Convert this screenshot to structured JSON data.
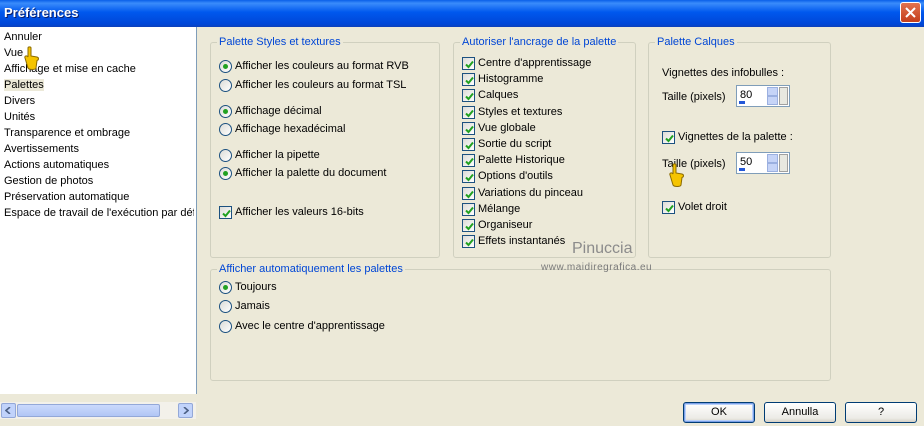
{
  "window": {
    "title": "Préférences"
  },
  "sidebar": {
    "items": [
      {
        "label": "Annuler"
      },
      {
        "label": "Vue"
      },
      {
        "label": "Affichage et mise en cache"
      },
      {
        "label": "Palettes"
      },
      {
        "label": "Divers"
      },
      {
        "label": "Unités"
      },
      {
        "label": "Transparence et ombrage"
      },
      {
        "label": "Avertissements"
      },
      {
        "label": "Actions automatiques"
      },
      {
        "label": "Gestion de photos"
      },
      {
        "label": "Préservation automatique"
      },
      {
        "label": "Espace de travail de l'exécution par déf"
      }
    ],
    "selected": "Palettes"
  },
  "group_styles": {
    "title": "Palette Styles et textures",
    "opt_rvb": "Afficher les couleurs au format RVB",
    "opt_tsl": "Afficher les couleurs au format TSL",
    "opt_dec": "Affichage décimal",
    "opt_hex": "Affichage hexadécimal",
    "opt_pip": "Afficher la pipette",
    "opt_doc": "Afficher la palette du document",
    "opt_16": "Afficher les valeurs 16-bits"
  },
  "group_dock": {
    "title": "Autoriser l'ancrage de la palette",
    "items": [
      "Centre d'apprentissage",
      "Histogramme",
      "Calques",
      "Styles et textures",
      "Vue globale",
      "Sortie du script",
      "Palette Historique",
      "Options d'outils",
      "Variations du pinceau",
      "Mélange",
      "Organiseur",
      "Effets instantanés"
    ]
  },
  "group_layers": {
    "title": "Palette Calques",
    "tooltip_thumbs": "Vignettes des infobulles :",
    "size_label_1": "Taille (pixels)",
    "size_value_1": "80",
    "palette_thumbs": "Vignettes de la palette :",
    "size_label_2": "Taille (pixels)",
    "size_value_2": "50",
    "right_pane": "Volet droit"
  },
  "group_auto": {
    "title": "Afficher automatiquement les palettes",
    "opt_always": "Toujours",
    "opt_never": "Jamais",
    "opt_learning": "Avec le centre d'apprentissage"
  },
  "buttons": {
    "ok": "OK",
    "cancel": "Annulla",
    "help": "?"
  },
  "watermark": {
    "name": "Pinuccia",
    "site": "www.maidiregrafica.eu"
  }
}
